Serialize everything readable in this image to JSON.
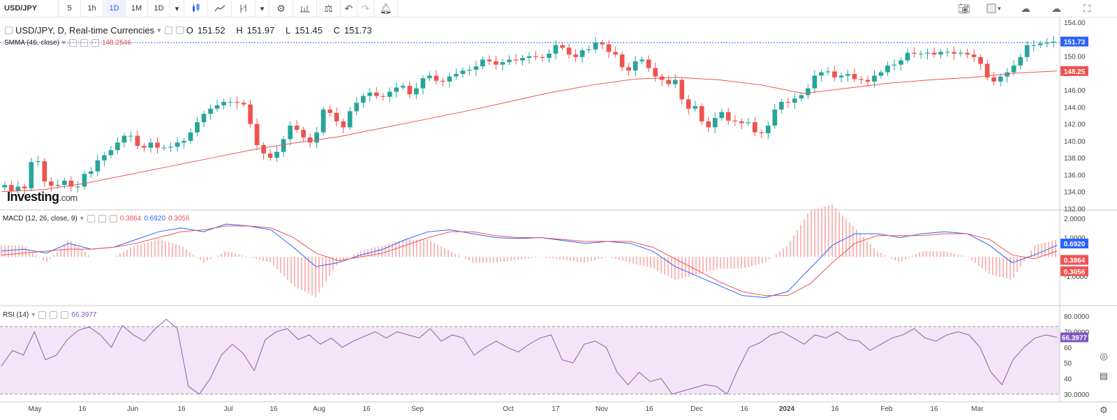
{
  "toolbar": {
    "symbol": "USD/JPY",
    "intervals": [
      "5",
      "1h",
      "1D",
      "1M"
    ],
    "active_interval": "1D",
    "interval_dropdown": "1D",
    "icons": [
      "candles-icon",
      "line-chart-icon",
      "indicators-icon",
      "dropdown-icon",
      "settings-icon",
      "bar-chart-icon",
      "compare-icon",
      "undo-icon",
      "redo-icon",
      "alert-icon"
    ],
    "right_icons": [
      "camera-icon",
      "layout-icon",
      "cloud-icon",
      "cloud-upload-icon",
      "fullscreen-icon"
    ]
  },
  "main_legend": {
    "title": "USD/JPY, D, Real-time Currencies",
    "open_label": "O",
    "open": "151.52",
    "high_label": "H",
    "high": "151.97",
    "low_label": "L",
    "low": "151.45",
    "close_label": "C",
    "close": "151.73"
  },
  "smma_legend": {
    "name": "SMMA (46, close)",
    "value": "148.2546"
  },
  "macd_legend": {
    "name": "MACD (12, 26, close, 9)",
    "hist": "0.3864",
    "macd": "0.6920",
    "signal": "0.3056"
  },
  "rsi_legend": {
    "name": "RSI (14)",
    "value": "66.3977"
  },
  "brand": {
    "name": "Investing",
    "suffix": ".com"
  },
  "colors": {
    "up": "#26a69a",
    "down": "#ef5350",
    "smma": "#ef5350",
    "macd": "#2962ff",
    "signal": "#ef5350",
    "rsi": "#7e57c2",
    "rsi_band": "#f3e5f5"
  },
  "chart_data": [
    {
      "type": "candlestick",
      "title": "USD/JPY, D, Real-time Currencies",
      "ylim": [
        132,
        154
      ],
      "yticks": [
        "154.00",
        "152.00",
        "150.00",
        "148.00",
        "146.00",
        "144.00",
        "142.00",
        "140.00",
        "138.00",
        "136.00",
        "134.00",
        "132.00"
      ],
      "xticks": [
        "May",
        "16",
        "Jun",
        "16",
        "Jul",
        "16",
        "Aug",
        "16",
        "Sep",
        "Oct",
        "17",
        "Nov",
        "16",
        "Dec",
        "16",
        "2024",
        "16",
        "Feb",
        "16",
        "Mar"
      ],
      "last_price_label": "151.73",
      "smma_label": "148.25",
      "price_points": [
        134.8,
        134.1,
        134.6,
        134.4,
        137.5,
        137.6,
        135.2,
        134.7,
        134.8,
        135.3,
        134.6,
        134.6,
        136.1,
        136.4,
        137.7,
        138.3,
        138.9,
        139.8,
        140.6,
        140.6,
        139.4,
        139.2,
        139.8,
        139.2,
        139.2,
        139.3,
        139.8,
        140.0,
        141.0,
        142.2,
        143.2,
        143.8,
        144.2,
        144.6,
        144.6,
        144.5,
        144.3,
        142.0,
        139.5,
        138.5,
        138.0,
        138.7,
        140.2,
        141.8,
        141.3,
        140.4,
        139.8,
        141.0,
        143.7,
        143.3,
        142.3,
        141.6,
        143.5,
        144.5,
        145.3,
        145.7,
        145.3,
        145.2,
        145.8,
        146.3,
        146.5,
        145.5,
        146.2,
        147.4,
        147.7,
        147.1,
        147.0,
        147.6,
        147.9,
        148.3,
        148.4,
        148.8,
        149.6,
        149.4,
        149.0,
        149.3,
        149.6,
        149.5,
        149.8,
        150.0,
        149.9,
        149.8,
        150.3,
        151.3,
        151.0,
        150.2,
        149.9,
        150.7,
        150.8,
        151.6,
        151.4,
        150.5,
        150.2,
        148.7,
        148.3,
        149.4,
        149.6,
        148.6,
        147.6,
        147.2,
        146.7,
        147.2,
        144.9,
        143.8,
        144.1,
        142.3,
        141.6,
        142.7,
        143.4,
        142.4,
        142.3,
        142.1,
        142.2,
        141.0,
        140.9,
        141.8,
        143.7,
        144.6,
        144.5,
        145.0,
        145.4,
        146.2,
        147.7,
        148.1,
        148.2,
        147.5,
        147.7,
        147.9,
        147.3,
        147.2,
        147.0,
        147.7,
        148.1,
        148.9,
        149.0,
        149.5,
        150.4,
        150.3,
        150.3,
        150.4,
        150.2,
        150.5,
        150.5,
        150.3,
        150.4,
        150.2,
        149.9,
        149.1,
        147.5,
        147.0,
        147.6,
        148.1,
        148.9,
        149.9,
        151.3,
        151.3,
        151.5,
        151.6,
        151.73
      ],
      "smma_points": [
        134.0,
        134.25,
        135.0,
        136.0,
        137.0,
        138.0,
        139.0,
        139.8,
        140.5,
        141.5,
        142.5,
        143.5,
        144.6,
        145.7,
        146.6,
        147.3,
        147.5,
        147.2,
        146.6,
        145.6,
        146.2,
        146.8,
        147.2,
        147.5,
        148.0,
        148.25
      ]
    },
    {
      "type": "line",
      "title": "MACD (12, 26, close, 9)",
      "yticks": [
        "2.0000",
        "1.0000",
        "0.0000",
        "-1.0000"
      ],
      "series": [
        {
          "name": "MACD",
          "values": [
            0.3,
            0.4,
            0.2,
            0.7,
            0.4,
            0.5,
            0.9,
            1.3,
            1.5,
            1.3,
            1.7,
            1.6,
            1.4,
            0.5,
            -0.5,
            -0.3,
            0.1,
            0.4,
            0.9,
            1.3,
            1.4,
            1.2,
            1.0,
            0.95,
            1.0,
            0.85,
            0.7,
            0.8,
            0.7,
            0.3,
            -0.5,
            -1.0,
            -1.5,
            -2.0,
            -2.1,
            -1.8,
            -0.6,
            0.6,
            1.2,
            1.2,
            1.0,
            1.2,
            1.3,
            1.2,
            0.6,
            -0.3,
            0.1,
            0.6
          ]
        },
        {
          "name": "Signal",
          "values": [
            0.1,
            0.2,
            0.3,
            0.4,
            0.4,
            0.5,
            0.7,
            1.0,
            1.3,
            1.4,
            1.6,
            1.6,
            1.5,
            1.0,
            0.2,
            -0.2,
            0.0,
            0.2,
            0.6,
            1.0,
            1.3,
            1.3,
            1.1,
            1.0,
            1.0,
            0.9,
            0.8,
            0.8,
            0.8,
            0.5,
            -0.1,
            -0.7,
            -1.3,
            -1.8,
            -2.0,
            -2.0,
            -1.4,
            -0.3,
            0.7,
            1.1,
            1.1,
            1.1,
            1.2,
            1.2,
            0.9,
            0.1,
            -0.1,
            0.3
          ]
        }
      ],
      "last_labels": [
        "0.6920",
        "0.3864",
        "0.3056"
      ]
    },
    {
      "type": "line",
      "title": "RSI (14)",
      "ylim": [
        25,
        85
      ],
      "yticks": [
        "80.0000",
        "70.0000",
        "60",
        "50",
        "40",
        "30.0000"
      ],
      "band": [
        30,
        70
      ],
      "values": [
        48,
        58,
        55,
        70,
        52,
        55,
        65,
        71,
        73,
        68,
        60,
        74,
        68,
        64,
        72,
        78,
        72,
        35,
        30,
        40,
        55,
        62,
        56,
        45,
        65,
        70,
        72,
        65,
        68,
        62,
        66,
        60,
        64,
        67,
        70,
        66,
        70,
        68,
        66,
        72,
        64,
        68,
        66,
        55,
        60,
        64,
        60,
        57,
        62,
        66,
        68,
        52,
        50,
        62,
        64,
        60,
        44,
        36,
        44,
        38,
        40,
        30,
        32,
        34,
        36,
        35,
        30,
        46,
        60,
        63,
        68,
        70,
        66,
        62,
        68,
        66,
        70,
        65,
        64,
        58,
        62,
        66,
        68,
        72,
        66,
        64,
        68,
        70,
        68,
        60,
        44,
        36,
        52,
        60,
        66,
        68,
        66.4
      ],
      "last_label": "66.3977"
    }
  ]
}
